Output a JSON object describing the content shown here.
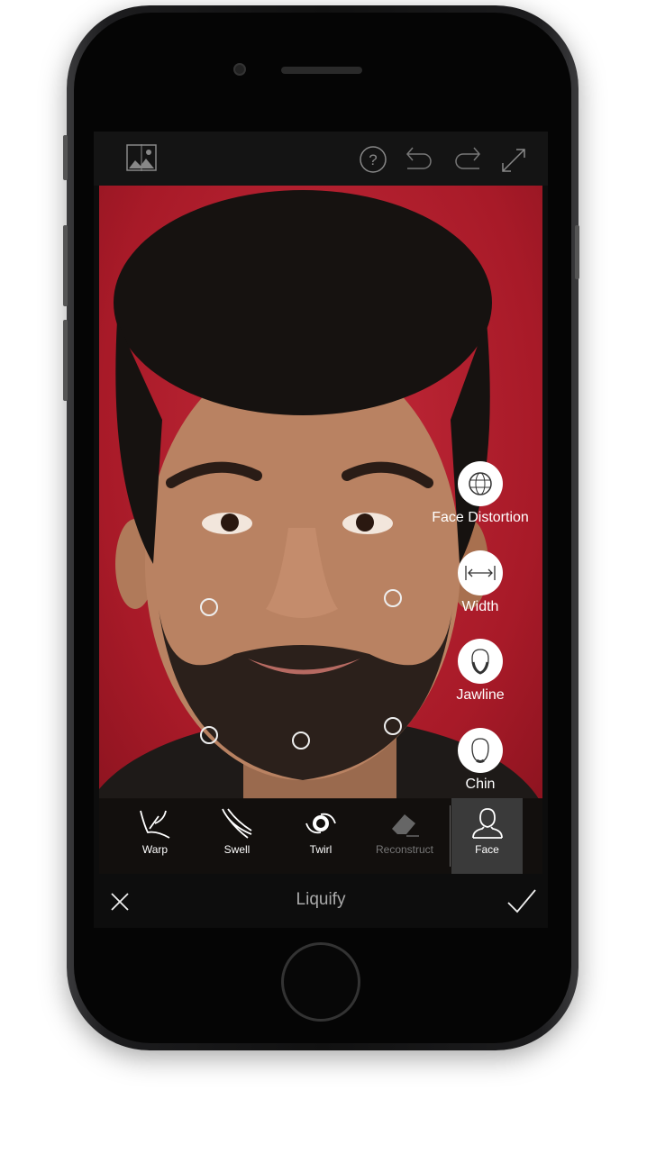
{
  "topbar": {
    "icons": [
      "compare-icon",
      "help-icon",
      "undo-icon",
      "redo-icon",
      "fullscreen-icon"
    ]
  },
  "face_controls": [
    {
      "label": "Face Distortion",
      "icon": "globe-grid-icon"
    },
    {
      "label": "Width",
      "icon": "width-arrows-icon"
    },
    {
      "label": "Jawline",
      "icon": "jawline-icon"
    },
    {
      "label": "Chin",
      "icon": "chin-icon"
    }
  ],
  "tools": [
    {
      "label": "Warp",
      "icon": "warp-hand-icon"
    },
    {
      "label": "Swell",
      "icon": "swell-icon"
    },
    {
      "label": "Twirl",
      "icon": "twirl-icon"
    },
    {
      "label": "Reconstruct",
      "icon": "eraser-icon",
      "disabled": true
    },
    {
      "label": "Face",
      "icon": "face-icon",
      "active": true
    }
  ],
  "bottombar": {
    "title": "Liquify",
    "cancel_icon": "close-icon",
    "confirm_icon": "checkmark-icon"
  },
  "colors": {
    "background": "#b8202e",
    "toolbar": "#141414",
    "active_tool": "#3a3a3a"
  }
}
